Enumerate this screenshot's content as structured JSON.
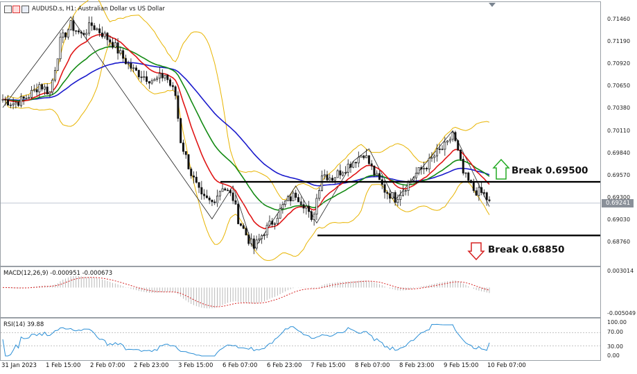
{
  "header": {
    "title": "AUDUSD.s, H1:  Australian Dollar vs US Dollar",
    "macd_title": "MACD(12,26,9) -0.000951 -0.000673",
    "rsi_title": "RSI(14) 39.88"
  },
  "price_axis": {
    "ticks": [
      "0.71460",
      "0.71190",
      "0.70920",
      "0.70650",
      "0.70380",
      "0.70110",
      "0.69840",
      "0.69570",
      "0.69300",
      "0.69030",
      "0.68760"
    ],
    "current": "0.69241"
  },
  "macd_axis": {
    "ticks": [
      "0.003014",
      "-0.005049"
    ]
  },
  "rsi_axis": {
    "ticks": [
      "100.00",
      "70.00",
      "30.00",
      "0.00"
    ]
  },
  "time_axis": {
    "labels": [
      "31 Jan 2023",
      "1 Feb 15:00",
      "2 Feb 07:00",
      "2 Feb 23:00",
      "3 Feb 15:00",
      "6 Feb 07:00",
      "6 Feb 23:00",
      "7 Feb 15:00",
      "8 Feb 07:00",
      "8 Feb 23:00",
      "9 Feb 15:00",
      "10 Feb 07:00"
    ]
  },
  "annotations": {
    "break_up": "Break 0.69500",
    "break_down": "Break 0.68850"
  },
  "colors": {
    "ma_blue": "#1a1acc",
    "ma_green": "#138a13",
    "ma_red": "#e01515",
    "bollinger": "#e8b400",
    "up_arrow": "#22aa22",
    "down_arrow": "#d62020",
    "macd_signal": "#d62020",
    "rsi": "#2b8fd6"
  },
  "chart_data": {
    "type": "candlestick",
    "symbol": "AUDUSD.s",
    "timeframe": "H1",
    "ylim": [
      0.6865,
      0.7155
    ],
    "levels": [
      {
        "name": "resistance",
        "value": 0.695
      },
      {
        "name": "support",
        "value": 0.6885
      },
      {
        "name": "last_price",
        "value": 0.69241
      }
    ],
    "close_path": [
      [
        0,
        0.705
      ],
      [
        4,
        0.7045
      ],
      [
        8,
        0.705
      ],
      [
        12,
        0.706
      ],
      [
        14,
        0.7068
      ],
      [
        18,
        0.7058
      ],
      [
        22,
        0.712
      ],
      [
        26,
        0.714
      ],
      [
        30,
        0.7128
      ],
      [
        34,
        0.714
      ],
      [
        38,
        0.713
      ],
      [
        42,
        0.7118
      ],
      [
        46,
        0.71
      ],
      [
        50,
        0.7085
      ],
      [
        54,
        0.7078
      ],
      [
        58,
        0.7072
      ],
      [
        62,
        0.708
      ],
      [
        66,
        0.7055
      ],
      [
        68,
        0.7
      ],
      [
        72,
        0.696
      ],
      [
        76,
        0.693
      ],
      [
        80,
        0.6925
      ],
      [
        84,
        0.6945
      ],
      [
        88,
        0.693
      ],
      [
        90,
        0.6905
      ],
      [
        94,
        0.688
      ],
      [
        96,
        0.687
      ],
      [
        100,
        0.689
      ],
      [
        104,
        0.6905
      ],
      [
        108,
        0.6925
      ],
      [
        112,
        0.6935
      ],
      [
        116,
        0.692
      ],
      [
        118,
        0.69
      ],
      [
        122,
        0.696
      ],
      [
        126,
        0.6955
      ],
      [
        130,
        0.6965
      ],
      [
        134,
        0.6975
      ],
      [
        138,
        0.6985
      ],
      [
        142,
        0.696
      ],
      [
        146,
        0.694
      ],
      [
        150,
        0.693
      ],
      [
        154,
        0.6945
      ],
      [
        158,
        0.696
      ],
      [
        162,
        0.697
      ],
      [
        166,
        0.6985
      ],
      [
        170,
        0.6995
      ],
      [
        172,
        0.701
      ],
      [
        176,
        0.696
      ],
      [
        180,
        0.694
      ],
      [
        184,
        0.6935
      ],
      [
        186,
        0.6924
      ]
    ],
    "series": [
      {
        "name": "MACD(12,26,9)",
        "value": -0.000951
      },
      {
        "name": "Signal",
        "value": -0.000673
      },
      {
        "name": "RSI(14)",
        "value": 39.88
      }
    ]
  }
}
